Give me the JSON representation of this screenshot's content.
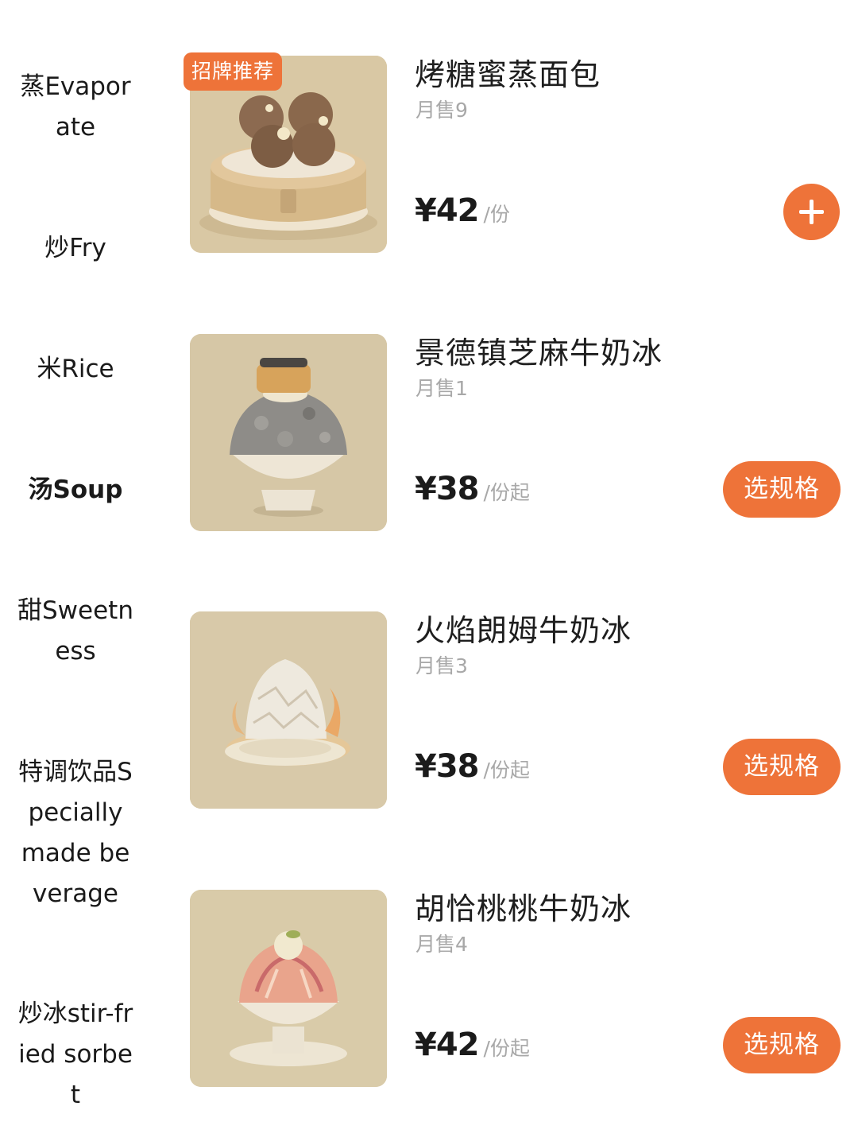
{
  "categories": [
    {
      "label": "蒸Evaporate"
    },
    {
      "label": "炒Fry"
    },
    {
      "label": "米Rice"
    },
    {
      "label": "汤Soup"
    },
    {
      "label": "甜Sweetness"
    },
    {
      "label": "特调饮品Specially made beverage"
    },
    {
      "label": "炒冰stir-fried sorbet"
    }
  ],
  "products": [
    {
      "name": "烤糖蜜蒸面包",
      "badge": "招牌推荐",
      "sales": "月售9",
      "price": "¥42",
      "unit": "/份",
      "action": "add"
    },
    {
      "name": "景德镇芝麻牛奶冰",
      "sales": "月售1",
      "price": "¥38",
      "unit": "/份起",
      "action": "选规格"
    },
    {
      "name": "火焰朗姆牛奶冰",
      "sales": "月售3",
      "price": "¥38",
      "unit": "/份起",
      "action": "选规格"
    },
    {
      "name": "胡恰桃桃牛奶冰",
      "sales": "月售4",
      "price": "¥42",
      "unit": "/份起",
      "action": "选规格"
    }
  ],
  "colors": {
    "accent": "#ee7339",
    "muted_text": "#a8a8a8",
    "thumb_bg": "#d9c9a6"
  },
  "icons": {
    "add": "plus-icon"
  }
}
